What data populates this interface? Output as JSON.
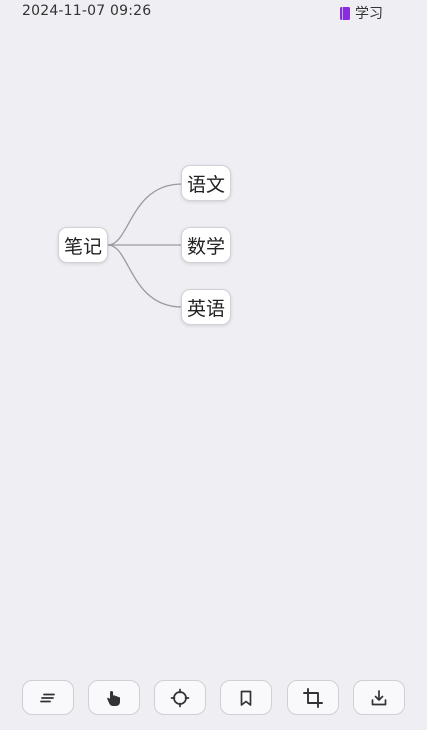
{
  "status": {
    "timestamp": "2024-11-07 09:26",
    "notebook_label": "学习",
    "notebook_color": "#8a2be2"
  },
  "mindmap": {
    "root": {
      "label": "笔记"
    },
    "children": [
      {
        "label": "语文"
      },
      {
        "label": "数学"
      },
      {
        "label": "英语"
      }
    ],
    "link_color": "#9a9aa0"
  },
  "toolbar": {
    "buttons": [
      {
        "icon": "outline-lines-icon"
      },
      {
        "icon": "hand-pointer-icon"
      },
      {
        "icon": "crosshair-target-icon"
      },
      {
        "icon": "bookmark-icon"
      },
      {
        "icon": "crop-icon"
      },
      {
        "icon": "download-icon"
      }
    ]
  }
}
